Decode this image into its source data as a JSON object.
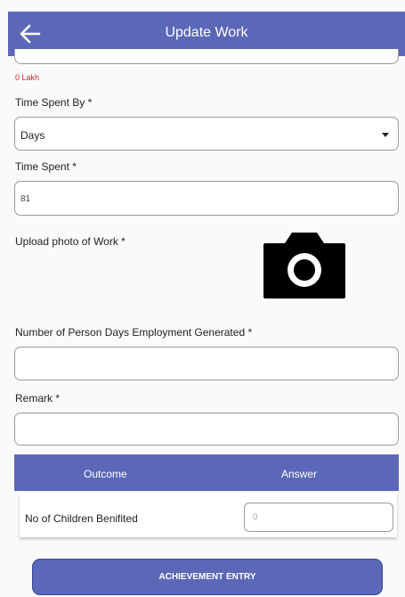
{
  "appbar": {
    "title": "Update Work",
    "back_icon": "arrow-left-icon"
  },
  "amount_note": "0 Lakh",
  "time_spent_by": {
    "label": "Time Spent By *",
    "value": "Days"
  },
  "time_spent": {
    "label": "Time Spent *",
    "value": "81"
  },
  "upload": {
    "label": "Upload photo of Work *",
    "icon": "camera-icon"
  },
  "person_days": {
    "label": "Number of Person Days Employment Generated *",
    "value": ""
  },
  "remark": {
    "label": "Remark *",
    "value": ""
  },
  "table": {
    "headers": [
      "Outcome",
      "Answer"
    ],
    "rows": [
      {
        "outcome": "No of Children Benifited",
        "answer_placeholder": "0"
      }
    ]
  },
  "submit_label": "ACHIEVEMENT ENTRY",
  "colors": {
    "primary": "#5b68b8",
    "error": "#c62828"
  }
}
